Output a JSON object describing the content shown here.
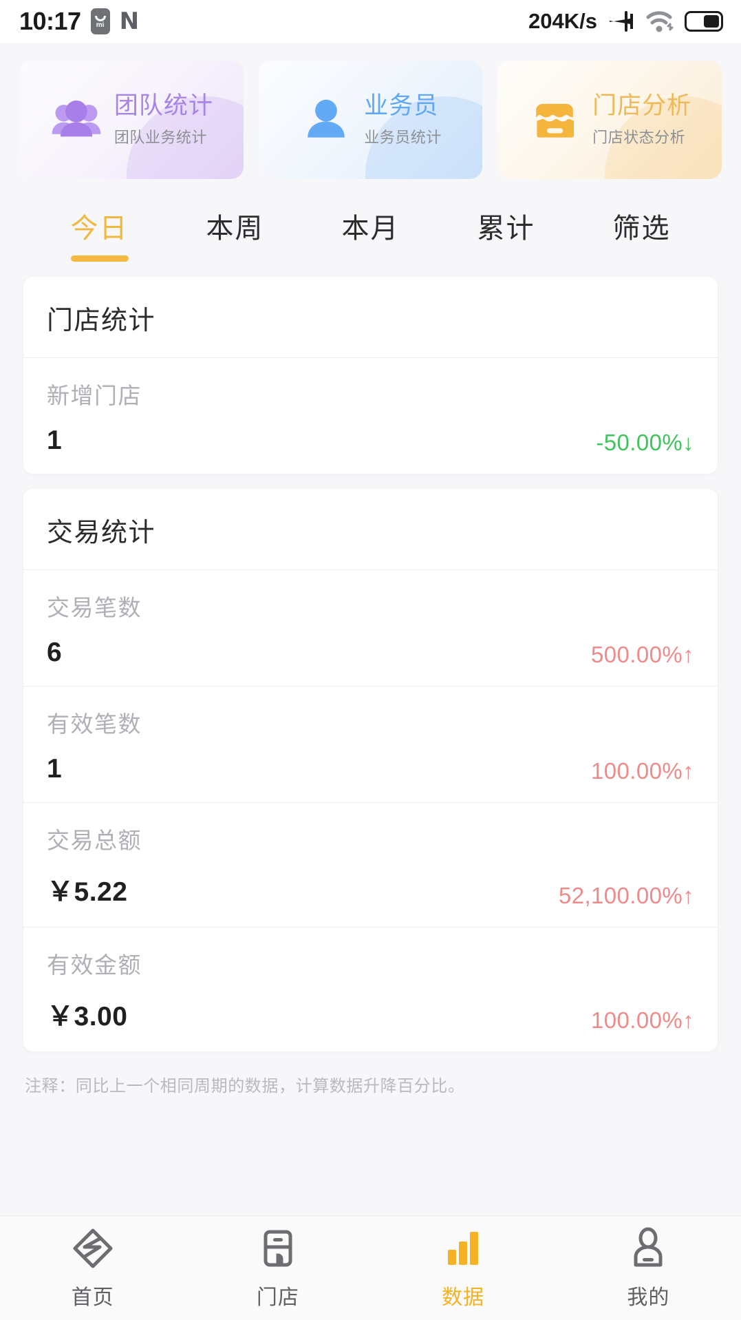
{
  "statusbar": {
    "time": "10:17",
    "mi_badge": "mi",
    "app_icon": "N",
    "network_speed": "204K/s",
    "icons": [
      "mi-badge-icon",
      "netease-n-icon",
      "airplane-mode-icon",
      "wifi-icon",
      "battery-icon"
    ]
  },
  "entry_cards": [
    {
      "title": "团队统计",
      "subtitle": "团队业务统计",
      "icon": "team-group-icon",
      "color": "#a884e6"
    },
    {
      "title": "业务员",
      "subtitle": "业务员统计",
      "icon": "person-icon",
      "color": "#61a8f4"
    },
    {
      "title": "门店分析",
      "subtitle": "门店状态分析",
      "icon": "store-icon",
      "color": "#edb95a"
    }
  ],
  "period_tabs": [
    {
      "label": "今日",
      "active": true
    },
    {
      "label": "本周",
      "active": false
    },
    {
      "label": "本月",
      "active": false
    },
    {
      "label": "累计",
      "active": false
    },
    {
      "label": "筛选",
      "active": false
    }
  ],
  "store_card": {
    "title": "门店统计",
    "rows": [
      {
        "label": "新增门店",
        "value": "1",
        "delta": "-50.00%↓",
        "direction": "down"
      }
    ]
  },
  "trade_card": {
    "title": "交易统计",
    "rows": [
      {
        "label": "交易笔数",
        "value": "6",
        "delta": "500.00%↑",
        "direction": "up"
      },
      {
        "label": "有效笔数",
        "value": "1",
        "delta": "100.00%↑",
        "direction": "up"
      },
      {
        "label": "交易总额",
        "value": "￥5.22",
        "delta": "52,100.00%↑",
        "direction": "up"
      },
      {
        "label": "有效金额",
        "value": "￥3.00",
        "delta": "100.00%↑",
        "direction": "up"
      }
    ]
  },
  "footnote": "注释：同比上一个相同周期的数据，计算数据升降百分比。",
  "bottom_nav": [
    {
      "label": "首页",
      "icon": "home-diamond-icon",
      "active": false
    },
    {
      "label": "门店",
      "icon": "store-outline-icon",
      "active": false
    },
    {
      "label": "数据",
      "icon": "bar-chart-icon",
      "active": true
    },
    {
      "label": "我的",
      "icon": "profile-icon",
      "active": false
    }
  ],
  "colors": {
    "accent": "#f5b840",
    "up": "#ef8a8a",
    "down": "#3fc35c",
    "page_bg": "#f7f7f9"
  }
}
